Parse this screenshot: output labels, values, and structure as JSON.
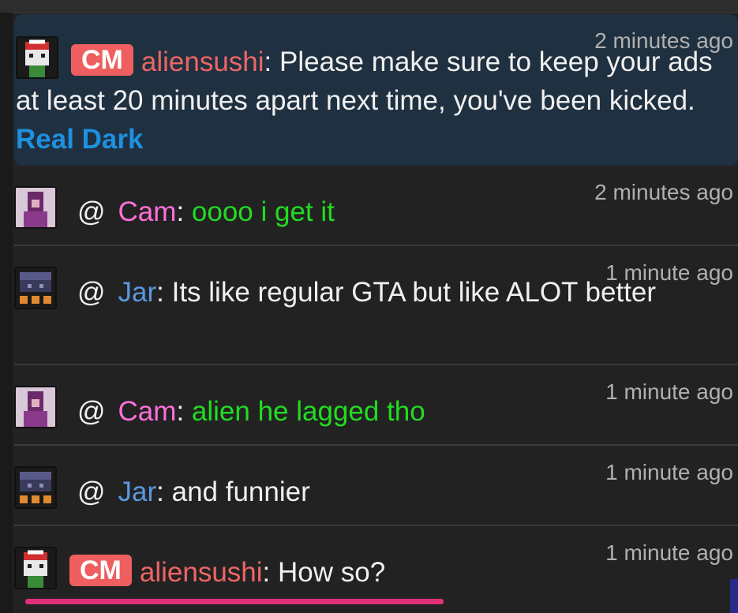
{
  "messages": [
    {
      "time": "2 minutes ago",
      "avatar_icon": "aliensushi-avatar-icon",
      "badge": "CM",
      "user": "aliensushi",
      "sep": ": ",
      "text": "Please make sure to keep your ads at least 20 minutes apart next time, you've been kicked. ",
      "link": "Real Dark",
      "highlighted": true
    },
    {
      "time": "2 minutes ago",
      "avatar_icon": "cam-avatar-icon",
      "at": "@",
      "user": "Cam",
      "sep": ": ",
      "text": "oooo i get it",
      "text_color": "#22dc22"
    },
    {
      "time": "1 minute ago",
      "avatar_icon": "jar-avatar-icon",
      "at": "@",
      "user": "Jar",
      "sep": ": ",
      "text": "Its like regular GTA but like ALOT better"
    },
    {
      "time": "1 minute ago",
      "avatar_icon": "cam-avatar-icon",
      "at": "@",
      "user": "Cam",
      "sep": ": ",
      "text": "alien he lagged tho",
      "text_color": "#22dc22"
    },
    {
      "time": "1 minute ago",
      "avatar_icon": "jar-avatar-icon",
      "at": "@",
      "user": "Jar",
      "sep": ": ",
      "text": "and funnier"
    },
    {
      "time": "1 minute ago",
      "avatar_icon": "aliensushi-avatar-icon",
      "badge": "CM",
      "user": "aliensushi",
      "sep": ": ",
      "text": "How so?"
    }
  ],
  "colors": {
    "background": "#222222",
    "highlight": "#1f3040",
    "badge": "#ef5f5f",
    "mod_name": "#ef6565",
    "cam_name": "#ff6fd9",
    "jar_name": "#5a98e0",
    "green_text": "#22dc22",
    "link": "#1e90e0",
    "underline": "#e0307a"
  }
}
